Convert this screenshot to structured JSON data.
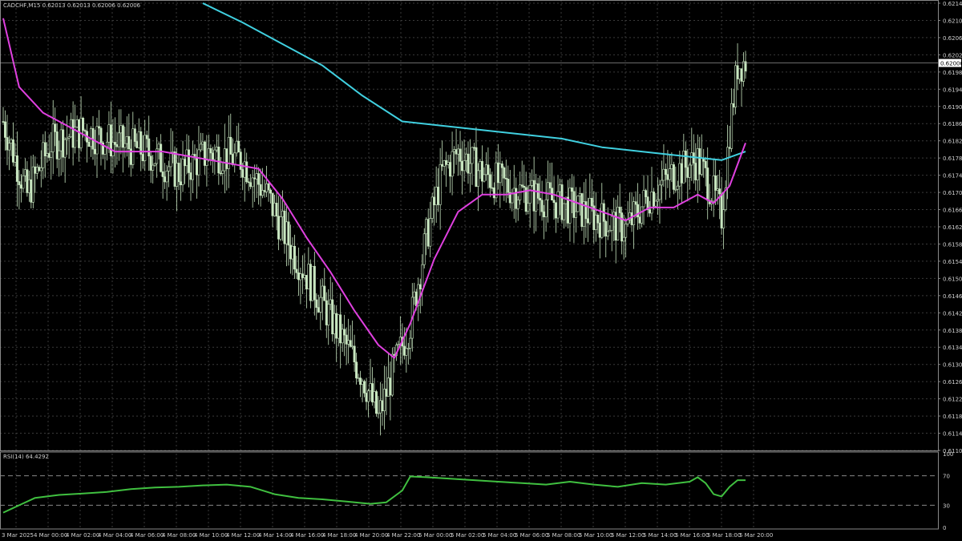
{
  "header": {
    "symbol_info": "CADCHF,M15  0.62013 0.62013 0.62006 0.62006",
    "rsi_info": "RSI(14) 64.4292"
  },
  "colors": {
    "background": "#000000",
    "grid": "#3a3a3a",
    "candle": "#c8e6c0",
    "ma_fast": "#e040e0",
    "ma_slow": "#40d0e0",
    "rsi": "#40c040",
    "current_price_bg": "#ffffff",
    "text": "#cfcfcf"
  },
  "chart_data": [
    {
      "type": "candlestick",
      "title": "CADCHF,M15",
      "ylim": [
        0.61105,
        0.62145
      ],
      "y_ticks": [
        "0.62145",
        "0.62105",
        "0.62065",
        "0.62025",
        "0.61985",
        "0.61945",
        "0.61905",
        "0.61865",
        "0.61825",
        "0.61785",
        "0.61745",
        "0.61705",
        "0.61665",
        "0.61625",
        "0.61585",
        "0.61545",
        "0.61505",
        "0.61465",
        "0.61425",
        "0.61385",
        "0.61345",
        "0.61305",
        "0.61265",
        "0.61225",
        "0.61185",
        "0.61145",
        "0.61105"
      ],
      "current_price": "0.62006",
      "x_ticks": [
        "3 Mar 2025",
        "4 Mar 00:00",
        "4 Mar 02:00",
        "4 Mar 04:00",
        "4 Mar 06:00",
        "4 Mar 08:00",
        "4 Mar 10:00",
        "4 Mar 12:00",
        "4 Mar 14:00",
        "4 Mar 16:00",
        "4 Mar 18:00",
        "4 Mar 20:00",
        "4 Mar 22:00",
        "5 Mar 00:00",
        "5 Mar 02:00",
        "5 Mar 04:00",
        "5 Mar 06:00",
        "5 Mar 08:00",
        "5 Mar 10:00",
        "5 Mar 12:00",
        "5 Mar 14:00",
        "5 Mar 16:00",
        "5 Mar 18:00",
        "5 Mar 20:00"
      ],
      "price_path": [
        [
          0,
          0.6187
        ],
        [
          3,
          0.617
        ],
        [
          6,
          0.6182
        ],
        [
          10,
          0.6185
        ],
        [
          14,
          0.6182
        ],
        [
          18,
          0.618
        ],
        [
          22,
          0.6175
        ],
        [
          26,
          0.618
        ],
        [
          30,
          0.6178
        ],
        [
          33,
          0.617
        ],
        [
          36,
          0.6158
        ],
        [
          39,
          0.6148
        ],
        [
          42,
          0.6138
        ],
        [
          45,
          0.6128
        ],
        [
          47,
          0.6118
        ],
        [
          49,
          0.613
        ],
        [
          51,
          0.614
        ],
        [
          53,
          0.616
        ],
        [
          55,
          0.6175
        ],
        [
          57,
          0.618
        ],
        [
          60,
          0.6175
        ],
        [
          63,
          0.6172
        ],
        [
          66,
          0.617
        ],
        [
          70,
          0.6168
        ],
        [
          74,
          0.6165
        ],
        [
          78,
          0.6162
        ],
        [
          81,
          0.617
        ],
        [
          84,
          0.6175
        ],
        [
          87,
          0.6178
        ],
        [
          89,
          0.617
        ],
        [
          90,
          0.6165
        ],
        [
          91,
          0.6185
        ],
        [
          92,
          0.62
        ],
        [
          93,
          0.6201
        ]
      ],
      "ma_fast": [
        [
          0,
          0.6211
        ],
        [
          2,
          0.6195
        ],
        [
          5,
          0.6189
        ],
        [
          8,
          0.6186
        ],
        [
          11,
          0.6183
        ],
        [
          14,
          0.618
        ],
        [
          17,
          0.618
        ],
        [
          20,
          0.618
        ],
        [
          23,
          0.6179
        ],
        [
          26,
          0.6178
        ],
        [
          29,
          0.6177
        ],
        [
          32,
          0.6176
        ],
        [
          35,
          0.6169
        ],
        [
          38,
          0.616
        ],
        [
          41,
          0.6152
        ],
        [
          44,
          0.6143
        ],
        [
          47,
          0.6135
        ],
        [
          49,
          0.6132
        ],
        [
          51,
          0.614
        ],
        [
          54,
          0.6155
        ],
        [
          57,
          0.6166
        ],
        [
          60,
          0.617
        ],
        [
          63,
          0.617
        ],
        [
          66,
          0.6171
        ],
        [
          69,
          0.617
        ],
        [
          72,
          0.6168
        ],
        [
          75,
          0.6166
        ],
        [
          78,
          0.6164
        ],
        [
          81,
          0.6167
        ],
        [
          84,
          0.6167
        ],
        [
          87,
          0.617
        ],
        [
          89,
          0.6168
        ],
        [
          91,
          0.6172
        ],
        [
          93,
          0.6182
        ]
      ],
      "ma_slow": [
        [
          25,
          0.62145
        ],
        [
          30,
          0.621
        ],
        [
          35,
          0.6205
        ],
        [
          40,
          0.62
        ],
        [
          45,
          0.6193
        ],
        [
          50,
          0.6187
        ],
        [
          55,
          0.6186
        ],
        [
          60,
          0.6185
        ],
        [
          65,
          0.6184
        ],
        [
          70,
          0.6183
        ],
        [
          75,
          0.6181
        ],
        [
          80,
          0.618
        ],
        [
          85,
          0.6179
        ],
        [
          90,
          0.6178
        ],
        [
          93,
          0.618
        ]
      ]
    },
    {
      "type": "line",
      "title": "RSI(14) 64.4292",
      "ylim": [
        0,
        100
      ],
      "y_ticks": [
        "100",
        "70",
        "30",
        "0"
      ],
      "levels": [
        70,
        30
      ],
      "values": [
        [
          0,
          20
        ],
        [
          2,
          30
        ],
        [
          4,
          40
        ],
        [
          7,
          44
        ],
        [
          10,
          46
        ],
        [
          13,
          48
        ],
        [
          16,
          52
        ],
        [
          19,
          54
        ],
        [
          22,
          55
        ],
        [
          25,
          57
        ],
        [
          28,
          58
        ],
        [
          31,
          55
        ],
        [
          34,
          45
        ],
        [
          37,
          40
        ],
        [
          40,
          38
        ],
        [
          43,
          35
        ],
        [
          46,
          32
        ],
        [
          48,
          34
        ],
        [
          50,
          50
        ],
        [
          51,
          69
        ],
        [
          53,
          68
        ],
        [
          56,
          66
        ],
        [
          59,
          64
        ],
        [
          62,
          62
        ],
        [
          65,
          60
        ],
        [
          68,
          58
        ],
        [
          71,
          62
        ],
        [
          74,
          58
        ],
        [
          77,
          55
        ],
        [
          80,
          60
        ],
        [
          83,
          58
        ],
        [
          86,
          62
        ],
        [
          87,
          68
        ],
        [
          88,
          60
        ],
        [
          89,
          45
        ],
        [
          90,
          42
        ],
        [
          91,
          55
        ],
        [
          92,
          64
        ],
        [
          93,
          64
        ]
      ]
    }
  ]
}
